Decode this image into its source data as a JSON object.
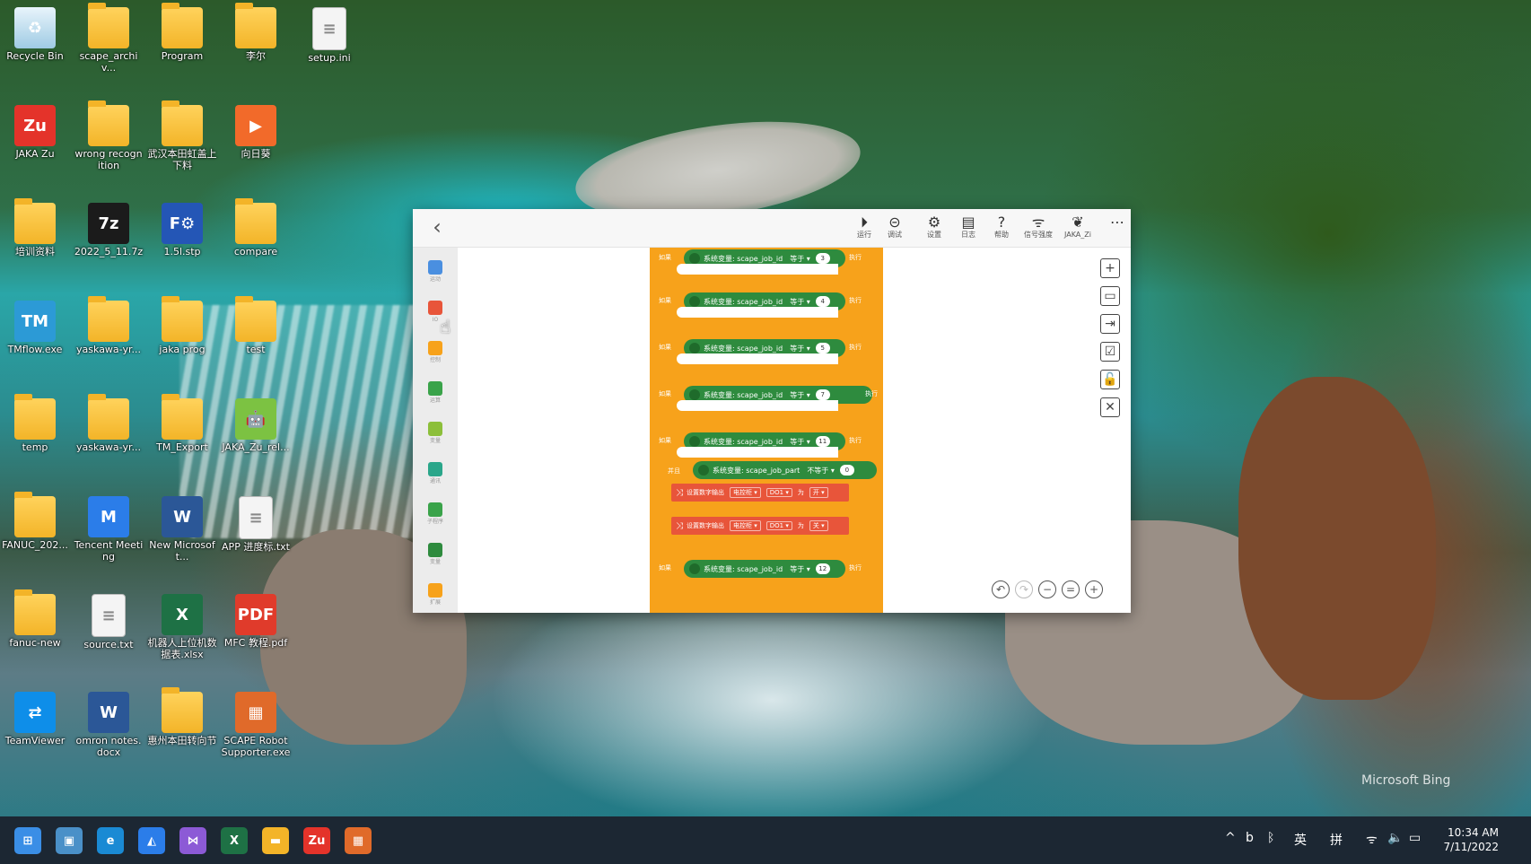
{
  "desktop": {
    "icons": [
      {
        "label": "Recycle Bin",
        "type": "bin",
        "glyph": "♻"
      },
      {
        "label": "scape_archiv...",
        "type": "folder",
        "glyph": ""
      },
      {
        "label": "Program",
        "type": "folder",
        "glyph": ""
      },
      {
        "label": "李尔",
        "type": "folder",
        "glyph": ""
      },
      {
        "label": "setup.ini",
        "type": "file",
        "glyph": "≡"
      },
      {
        "label": "JAKA Zu",
        "type": "app",
        "glyph": "Zu",
        "color": "#e4332a"
      },
      {
        "label": "wrong recognition",
        "type": "folder",
        "glyph": ""
      },
      {
        "label": "武汉本田虹盖上下料",
        "type": "folder",
        "glyph": ""
      },
      {
        "label": "向日葵",
        "type": "app",
        "glyph": "▶",
        "color": "#f26a2a"
      },
      {
        "label": "培训资料",
        "type": "folder",
        "glyph": ""
      },
      {
        "label": "2022_5_11.7z",
        "type": "app",
        "glyph": "7z",
        "color": "#1b1b1b"
      },
      {
        "label": "1.5l.stp",
        "type": "app",
        "glyph": "F⚙",
        "color": "#2456b6"
      },
      {
        "label": "compare",
        "type": "folder",
        "glyph": ""
      },
      {
        "label": "TMflow.exe",
        "type": "app",
        "glyph": "TM",
        "color": "#2c9ad6"
      },
      {
        "label": "yaskawa-yr...",
        "type": "folder",
        "glyph": ""
      },
      {
        "label": "jaka prog",
        "type": "folder",
        "glyph": ""
      },
      {
        "label": "test",
        "type": "folder",
        "glyph": ""
      },
      {
        "label": "temp",
        "type": "folder",
        "glyph": ""
      },
      {
        "label": "yaskawa-yr...",
        "type": "folder",
        "glyph": ""
      },
      {
        "label": "TM_Export",
        "type": "folder",
        "glyph": ""
      },
      {
        "label": "JAKA_Zu_rel...",
        "type": "app",
        "glyph": "🤖",
        "color": "#7cc242"
      },
      {
        "label": "FANUC_202...",
        "type": "folder",
        "glyph": ""
      },
      {
        "label": "Tencent Meeting",
        "type": "app",
        "glyph": "M",
        "color": "#2b7de9"
      },
      {
        "label": "New Microsoft...",
        "type": "app",
        "glyph": "W",
        "color": "#2b5797"
      },
      {
        "label": "APP 进度标.txt",
        "type": "file",
        "glyph": "≡"
      },
      {
        "label": "fanuc-new",
        "type": "folder",
        "glyph": ""
      },
      {
        "label": "source.txt",
        "type": "file",
        "glyph": "≡"
      },
      {
        "label": "机器人上位机数据表.xlsx",
        "type": "app",
        "glyph": "X",
        "color": "#1e7145"
      },
      {
        "label": "MFC 教程.pdf",
        "type": "app",
        "glyph": "PDF",
        "color": "#e03b2b"
      },
      {
        "label": "TeamViewer",
        "type": "app",
        "glyph": "⇄",
        "color": "#0e8ee9"
      },
      {
        "label": "omron notes.docx",
        "type": "app",
        "glyph": "W",
        "color": "#2b5797"
      },
      {
        "label": "惠州本田转向节",
        "type": "folder",
        "glyph": ""
      },
      {
        "label": "SCAPE Robot Supporter.exe",
        "type": "app",
        "glyph": "▦",
        "color": "#e06a2a"
      }
    ],
    "watermark": "Microsoft Bing"
  },
  "app": {
    "toolbar": {
      "buttons": [
        {
          "label": "运行",
          "icon": "play-icon",
          "glyph": "⏵"
        },
        {
          "label": "调试",
          "icon": "debug-icon",
          "glyph": "⊝"
        },
        {
          "label": "设置",
          "icon": "gear-icon",
          "glyph": "⚙"
        },
        {
          "label": "日志",
          "icon": "log-icon",
          "glyph": "▤"
        },
        {
          "label": "帮助",
          "icon": "help-icon",
          "glyph": "?"
        },
        {
          "label": "信号强度",
          "icon": "wifi-icon",
          "glyph": "ᯤ"
        },
        {
          "label": "JAKA_Zi",
          "icon": "robot-icon",
          "glyph": "❦"
        },
        {
          "label": "",
          "icon": "more-icon",
          "glyph": "⋯"
        }
      ]
    },
    "sidebar": [
      {
        "label": "运动",
        "color": "#4a8fe0"
      },
      {
        "label": "IO",
        "color": "#e8553a"
      },
      {
        "label": "控制",
        "color": "#f7a21b"
      },
      {
        "label": "运算",
        "color": "#3aa34a"
      },
      {
        "label": "变量",
        "color": "#8cbf3a"
      },
      {
        "label": "通讯",
        "color": "#2aa68a"
      },
      {
        "label": "子程序",
        "color": "#3aa34a"
      },
      {
        "label": "变量",
        "color": "#2e8b3e"
      },
      {
        "label": "扩展",
        "color": "#f7a21b"
      }
    ],
    "blocks": {
      "if_label": "如果",
      "then_label": "执行",
      "var_label": "系统变量: scape_job_id",
      "var2_label": "系统变量: scape_job_part",
      "eq": "等于 ▾",
      "neq": "不等于 ▾",
      "and": "并且",
      "conditions": [
        "3",
        "4",
        "5",
        "7",
        "11",
        "12"
      ],
      "cond2_value": "0",
      "actions": [
        {
          "label": "设置数字输出",
          "type": "电控柜 ▾",
          "port": "DO1 ▾",
          "set": "为",
          "value": "开 ▾"
        },
        {
          "label": "设置数字输出",
          "type": "电控柜 ▾",
          "port": "DO1 ▾",
          "set": "为",
          "value": "关 ▾"
        }
      ]
    },
    "right_tools": [
      "+",
      "▭",
      "⇥",
      "☑",
      "🔓",
      "✕"
    ],
    "zoom_tools": [
      "↶",
      "↷",
      "−",
      "=",
      "+"
    ]
  },
  "taskbar": {
    "apps": [
      {
        "name": "start-icon",
        "glyph": "⊞",
        "color": "#3a8ee6"
      },
      {
        "name": "desktop-icon",
        "glyph": "▣",
        "color": "#4a90c8"
      },
      {
        "name": "edge-icon",
        "glyph": "e",
        "color": "#1a8ad4"
      },
      {
        "name": "photos-icon",
        "glyph": "◭",
        "color": "#2b7de9"
      },
      {
        "name": "visual-studio-icon",
        "glyph": "⋈",
        "color": "#8c5ad6"
      },
      {
        "name": "excel-icon",
        "glyph": "X",
        "color": "#1e7145"
      },
      {
        "name": "file-explorer-icon",
        "glyph": "▬",
        "color": "#f3b428"
      },
      {
        "name": "jaka-zu-icon",
        "glyph": "Zu",
        "color": "#e4332a"
      },
      {
        "name": "scape-icon",
        "glyph": "▦",
        "color": "#e06a2a"
      }
    ],
    "tray": [
      "^",
      "b",
      "ᛒ",
      "英",
      "拼",
      "ᯤ",
      "🔈",
      "▭"
    ],
    "time": "10:34 AM",
    "date": "7/11/2022"
  }
}
